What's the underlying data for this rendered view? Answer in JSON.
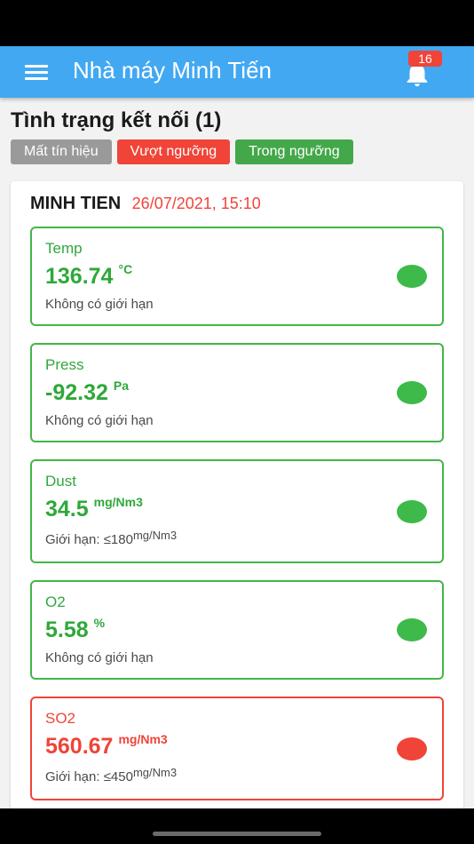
{
  "header": {
    "title": "Nhà máy Minh Tiến",
    "notification_count": "16",
    "icons": {
      "menu": "hamburger-menu-icon",
      "notifications": "bell-icon"
    }
  },
  "connection": {
    "title": "Tình trạng kết nối (1)",
    "legend": [
      {
        "label": "Mất tín hiệu",
        "color": "#9a9a9a"
      },
      {
        "label": "Vượt ngưỡng",
        "color": "#f04438"
      },
      {
        "label": "Trong ngưỡng",
        "color": "#43a849"
      }
    ]
  },
  "station": {
    "name": "MINH TIEN",
    "timestamp": "26/07/2021, 15:10",
    "sensors": [
      {
        "name": "Temp",
        "value": "136.74",
        "unit": "°C",
        "limit": "Không có giới hạn",
        "status": "within"
      },
      {
        "name": "Press",
        "value": "-92.32",
        "unit": "Pa",
        "limit": "Không có giới hạn",
        "status": "within"
      },
      {
        "name": "Dust",
        "value": "34.5",
        "unit": "mg/Nm3",
        "limit": "Giới hạn: ≤180",
        "limit_unit": "mg/Nm3",
        "status": "within"
      },
      {
        "name": "O2",
        "value": "5.58",
        "unit": "%",
        "limit": "Không có giới hạn",
        "status": "within"
      },
      {
        "name": "SO2",
        "value": "560.67",
        "unit": "mg/Nm3",
        "limit": "Giới hạn: ≤450",
        "limit_unit": "mg/Nm3",
        "status": "exceeded"
      }
    ]
  },
  "colors": {
    "appbar": "#42a8f2",
    "within": "#3dba4a",
    "exceeded": "#f04438",
    "lost": "#9a9a9a"
  }
}
